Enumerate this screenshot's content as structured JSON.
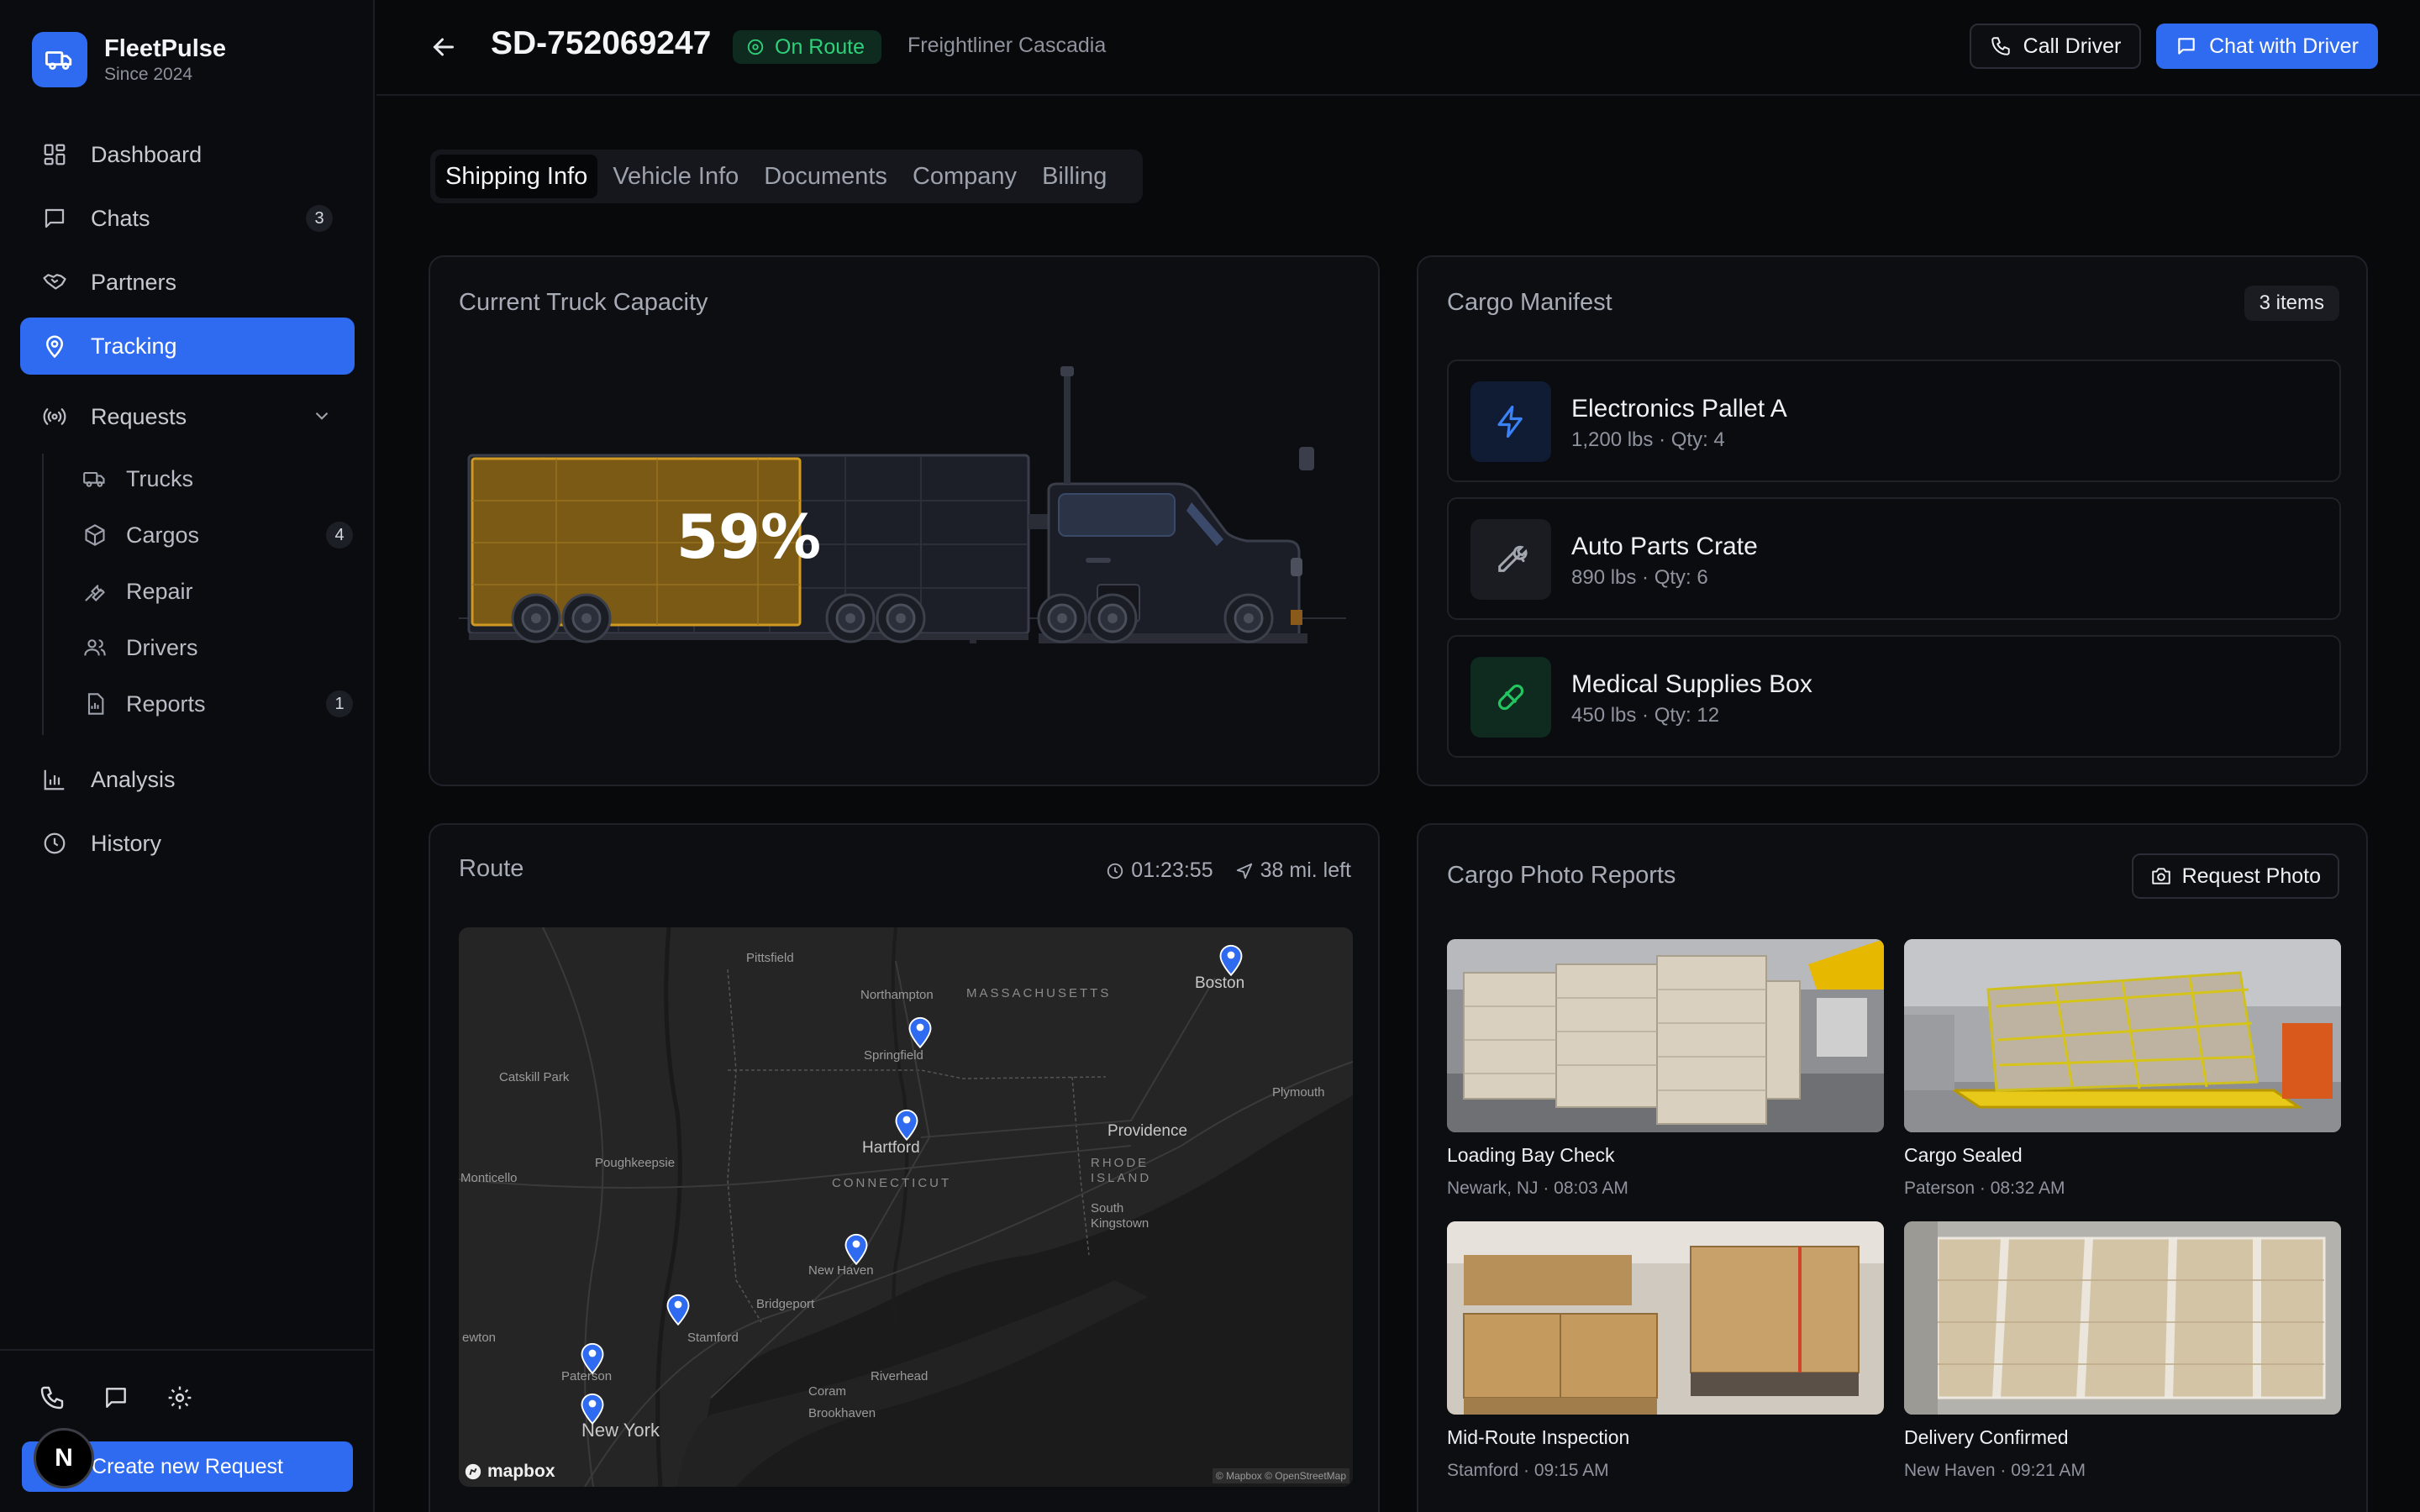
{
  "brand": {
    "name": "FleetPulse",
    "since": "Since 2024"
  },
  "sidebar": {
    "nav": [
      {
        "label": "Dashboard",
        "icon": "dashboard-icon"
      },
      {
        "label": "Chats",
        "icon": "chat-icon",
        "badge": "3"
      },
      {
        "label": "Partners",
        "icon": "handshake-icon"
      },
      {
        "label": "Tracking",
        "icon": "map-pin-icon",
        "active": true
      },
      {
        "label": "Requests",
        "icon": "broadcast-icon"
      }
    ],
    "requests_sub": [
      {
        "label": "Trucks",
        "icon": "truck-icon"
      },
      {
        "label": "Cargos",
        "icon": "package-icon",
        "badge": "4"
      },
      {
        "label": "Repair",
        "icon": "wrench-icon"
      },
      {
        "label": "Drivers",
        "icon": "users-icon"
      },
      {
        "label": "Reports",
        "icon": "report-icon",
        "badge": "1"
      }
    ],
    "nav2": [
      {
        "label": "Analysis",
        "icon": "bar-chart-icon"
      },
      {
        "label": "History",
        "icon": "clock-icon"
      }
    ],
    "create_button": "Create new Request",
    "avatar_letter": "N"
  },
  "header": {
    "shipment_id": "SD-752069247",
    "status": "On Route",
    "vehicle_model": "Freightliner Cascadia",
    "call_button": "Call Driver",
    "chat_button": "Chat with Driver"
  },
  "tabs": [
    "Shipping Info",
    "Vehicle Info",
    "Documents",
    "Company",
    "Billing"
  ],
  "capacity": {
    "title": "Current Truck Capacity",
    "percent_label": "59%",
    "fill_fraction": 0.59
  },
  "manifest": {
    "title": "Cargo Manifest",
    "count_label": "3 items",
    "items": [
      {
        "name": "Electronics Pallet A",
        "meta": "1,200 lbs · Qty: 4",
        "icon": "bolt-icon",
        "color": "#3b82f6"
      },
      {
        "name": "Auto Parts Crate",
        "meta": "890 lbs · Qty: 6",
        "icon": "wrench-icon",
        "color": "#a3a7b0"
      },
      {
        "name": "Medical Supplies Box",
        "meta": "450 lbs · Qty: 12",
        "icon": "pill-icon",
        "color": "#22c55e"
      }
    ]
  },
  "route": {
    "title": "Route",
    "eta": "01:23:55",
    "distance": "38 mi. left",
    "map_labels": {
      "pittsfield": "Pittsfield",
      "northampton": "Northampton",
      "massachusetts": "MASSACHUSETTS",
      "boston": "Boston",
      "springfield": "Springfield",
      "catskill": "Catskill Park",
      "plymouth": "Plymouth",
      "hartford": "Hartford",
      "providence": "Providence",
      "poughkeepsie": "Poughkeepsie",
      "rhode_island": "RHODE ISLAND",
      "connecticut": "CONNECTICUT",
      "monticello": "Monticello",
      "south_kingstown": "South Kingstown",
      "new_haven": "New Haven",
      "bridgeport": "Bridgeport",
      "stamford": "Stamford",
      "paterson": "Paterson",
      "newton": "ewton",
      "riverhead": "Riverhead",
      "coram": "Coram",
      "brookhaven": "Brookhaven",
      "new_york": "New York"
    },
    "mapbox": "mapbox",
    "attribution": "© Mapbox © OpenStreetMap"
  },
  "photos": {
    "title": "Cargo Photo Reports",
    "request_button": "Request Photo",
    "items": [
      {
        "title": "Loading Bay Check",
        "meta": "Newark, NJ · 08:03 AM"
      },
      {
        "title": "Cargo Sealed",
        "meta": "Paterson · 08:32 AM"
      },
      {
        "title": "Mid-Route Inspection",
        "meta": "Stamford · 09:15 AM"
      },
      {
        "title": "Delivery Confirmed",
        "meta": "New Haven · 09:21 AM"
      }
    ]
  },
  "colors": {
    "accent": "#2f6bf0",
    "status_green": "#2fd07a",
    "cargo_fill": "#7a5a14",
    "cargo_border": "#d09a22"
  }
}
